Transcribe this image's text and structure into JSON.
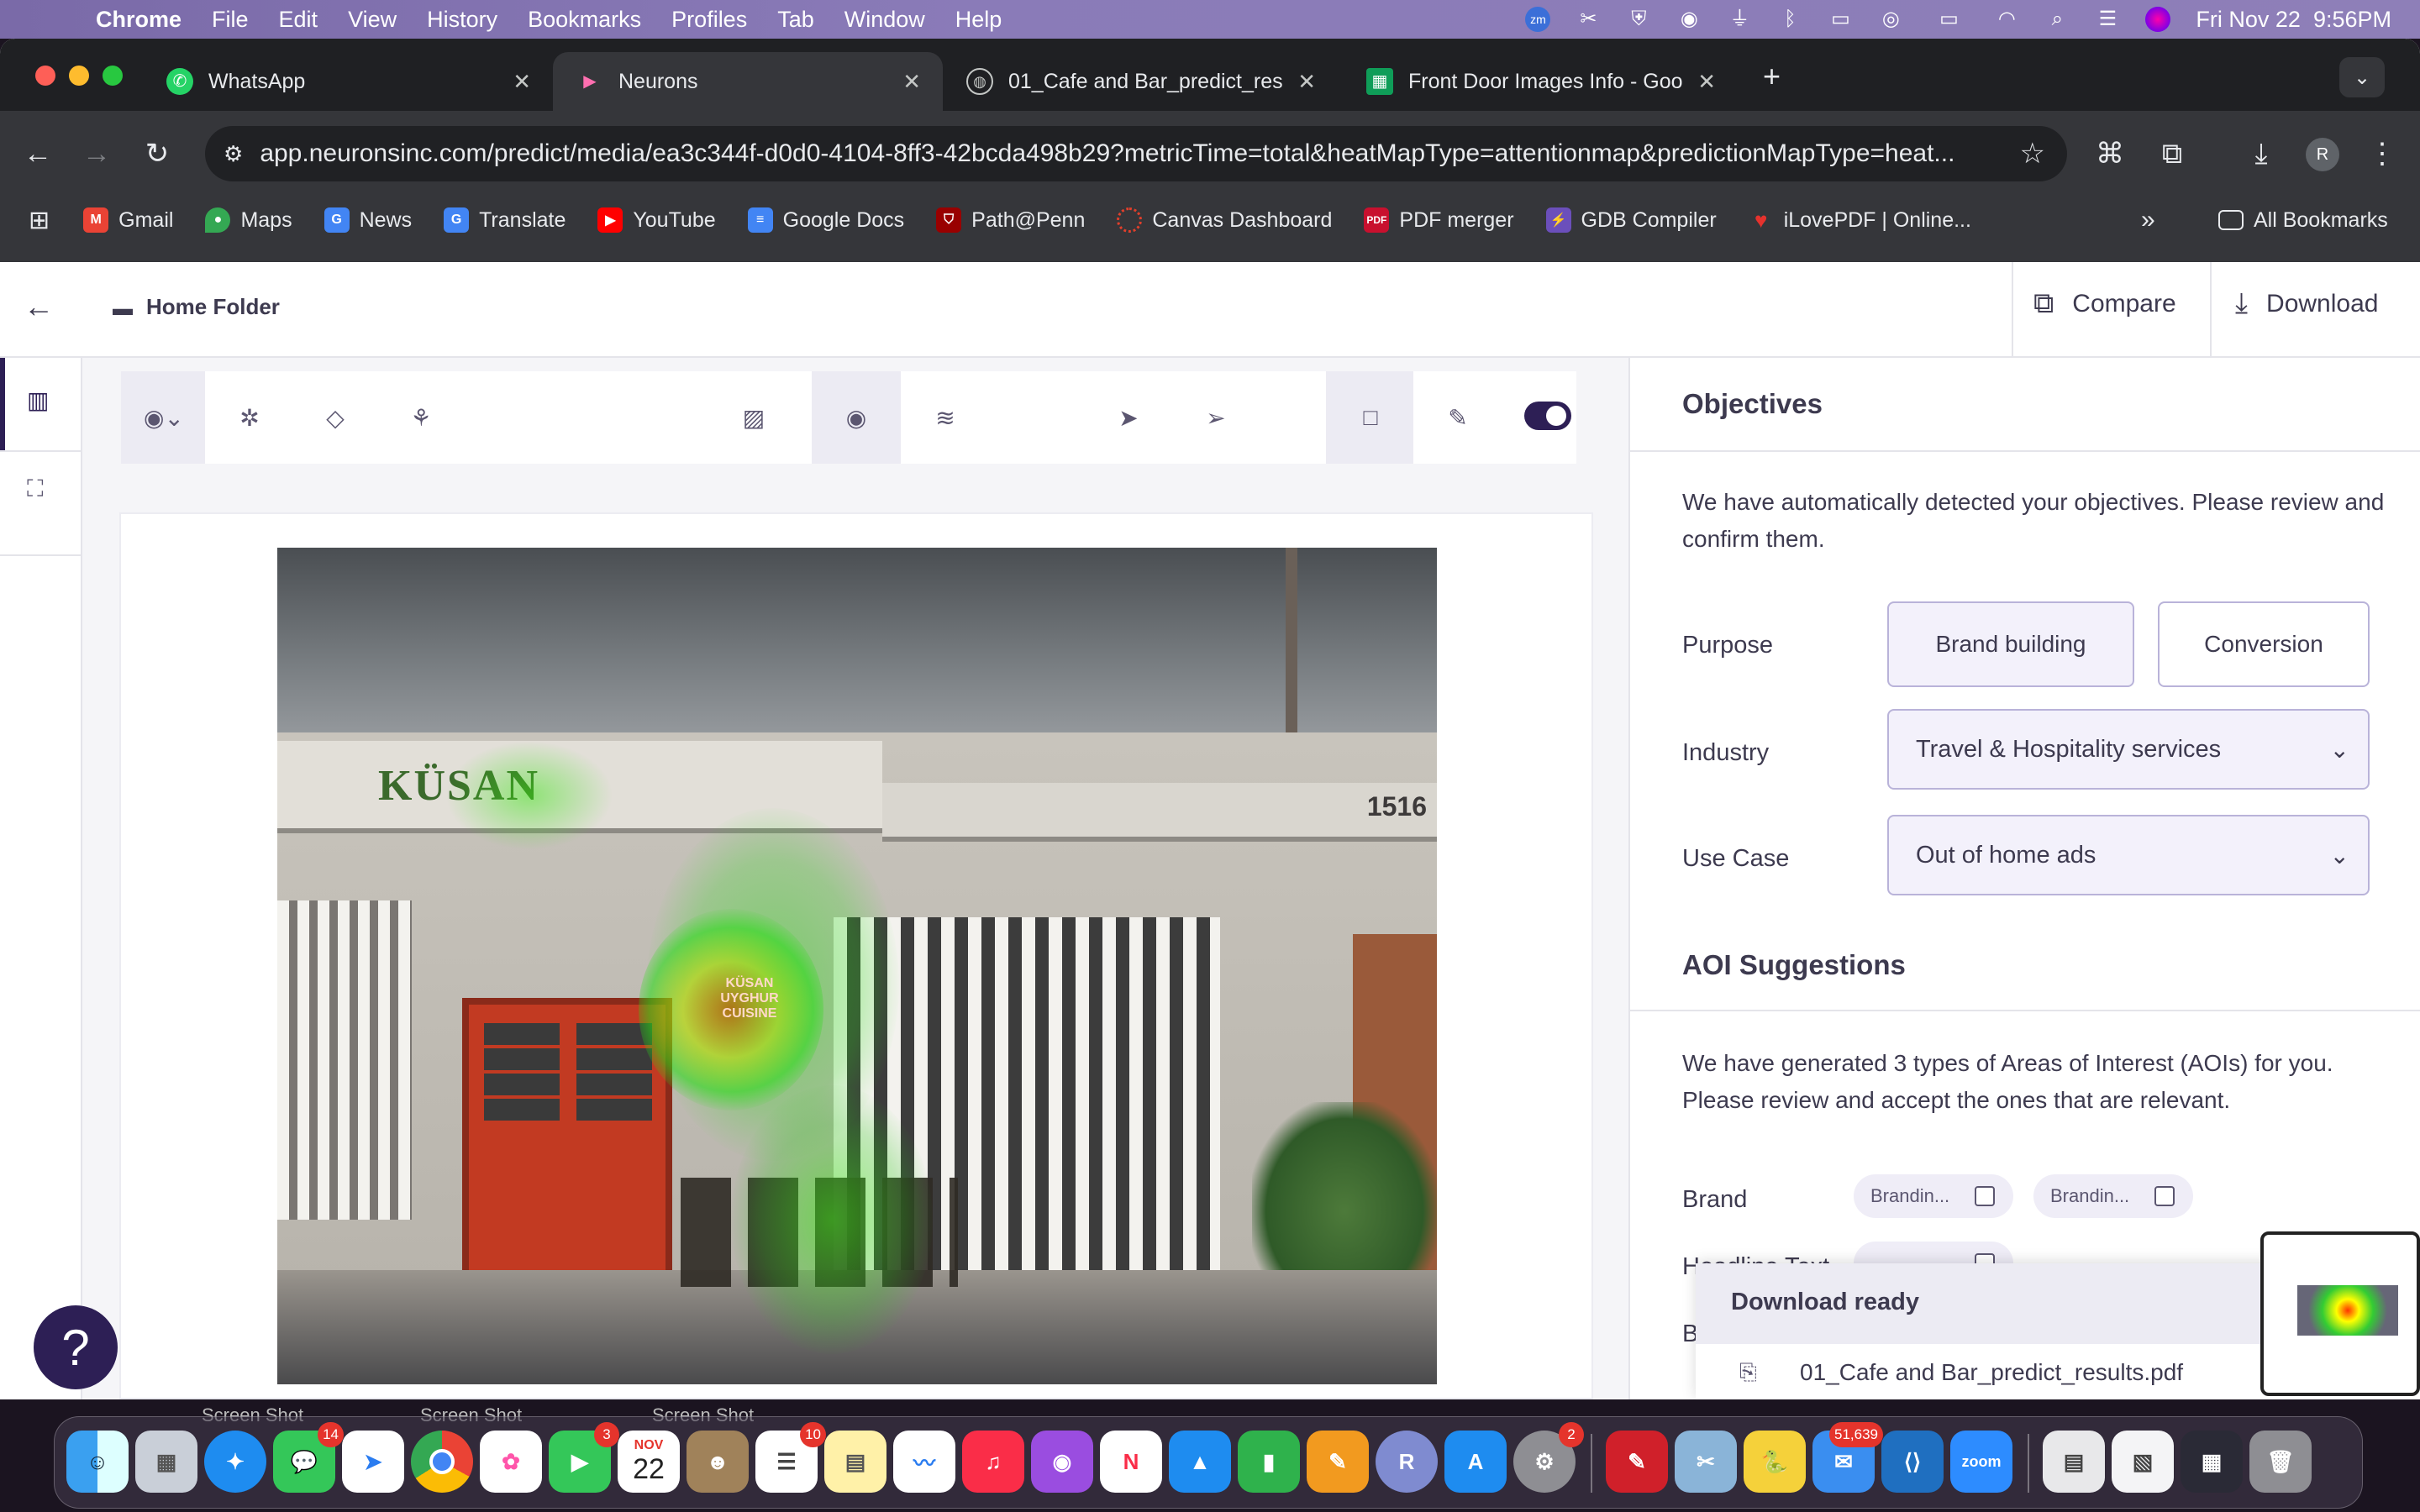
{
  "menubar": {
    "app_name": "Chrome",
    "items": [
      "File",
      "Edit",
      "View",
      "History",
      "Bookmarks",
      "Profiles",
      "Tab",
      "Window",
      "Help"
    ],
    "clock": "Fri Nov 22  9:56PM"
  },
  "tabs": [
    {
      "title": "WhatsApp"
    },
    {
      "title": "Neurons"
    },
    {
      "title": "01_Cafe and Bar_predict_res"
    },
    {
      "title": "Front Door Images Info - Goo"
    }
  ],
  "address_bar": {
    "url": "app.neuronsinc.com/predict/media/ea3c344f-d0d0-4104-8ff3-42bcda498b29?metricTime=total&heatMapType=attentionmap&predictionMapType=heat..."
  },
  "profile_initial": "R",
  "bookmarks": [
    {
      "label": "Gmail",
      "icon": "gmail-icon",
      "color": "#ea4335"
    },
    {
      "label": "Maps",
      "icon": "maps-icon",
      "color": "#34a853"
    },
    {
      "label": "News",
      "icon": "news-icon",
      "color": "#4285f4"
    },
    {
      "label": "Translate",
      "icon": "translate-icon",
      "color": "#4285f4"
    },
    {
      "label": "YouTube",
      "icon": "youtube-icon",
      "color": "#ff0000"
    },
    {
      "label": "Google Docs",
      "icon": "docs-icon",
      "color": "#4285f4"
    },
    {
      "label": "Path@Penn",
      "icon": "penn-icon",
      "color": "#990000"
    },
    {
      "label": "Canvas Dashboard",
      "icon": "canvas-icon",
      "color": "#e13f2b"
    },
    {
      "label": "PDF merger",
      "icon": "pdf-icon",
      "color": "#c8102e"
    },
    {
      "label": "GDB Compiler",
      "icon": "gdb-icon",
      "color": "#6b4fbb"
    },
    {
      "label": "iLovePDF | Online...",
      "icon": "ilovepdf-icon",
      "color": "#e5322d"
    }
  ],
  "all_bookmarks_label": "All Bookmarks",
  "app_header": {
    "breadcrumb": "Home Folder",
    "compare_label": "Compare",
    "download_label": "Download"
  },
  "objectives": {
    "title": "Objectives",
    "description": "We have automatically detected your objectives. Please review and confirm them.",
    "purpose_label": "Purpose",
    "purpose_options": [
      "Brand building",
      "Conversion"
    ],
    "industry_label": "Industry",
    "industry_value": "Travel & Hospitality services",
    "use_case_label": "Use Case",
    "use_case_value": "Out of home ads"
  },
  "aoi": {
    "title": "AOI Suggestions",
    "description": "We have generated 3 types of Areas of Interest (AOIs) for you. Please review and accept the ones that are relevant.",
    "brand_label": "Brand",
    "brand_chips": [
      "Brandin...",
      "Brandin..."
    ],
    "headline_label": "Headline Text",
    "third_label": "B"
  },
  "download_popup": {
    "title": "Download ready",
    "file_name": "01_Cafe and Bar_predict_results.pdf"
  },
  "image_signage": {
    "store_name": "KÜSAN",
    "address_number": "1516",
    "window_sign": "KÜSAN UYGHUR CUISINE"
  },
  "desktop_labels": [
    "Screen Shot",
    "Screen Shot",
    "Screen Shot"
  ],
  "dock": {
    "calendar_month": "NOV",
    "calendar_day": "22",
    "badges": {
      "messages": "14",
      "facetime": "3",
      "reminders": "10",
      "settings": "2",
      "mail": "51,639"
    },
    "zoom_label": "zoom"
  },
  "colors": {
    "accent": "#2d1f55",
    "purple_panel_border": "#b9b3d9",
    "menubar": "#8a7bb8"
  }
}
